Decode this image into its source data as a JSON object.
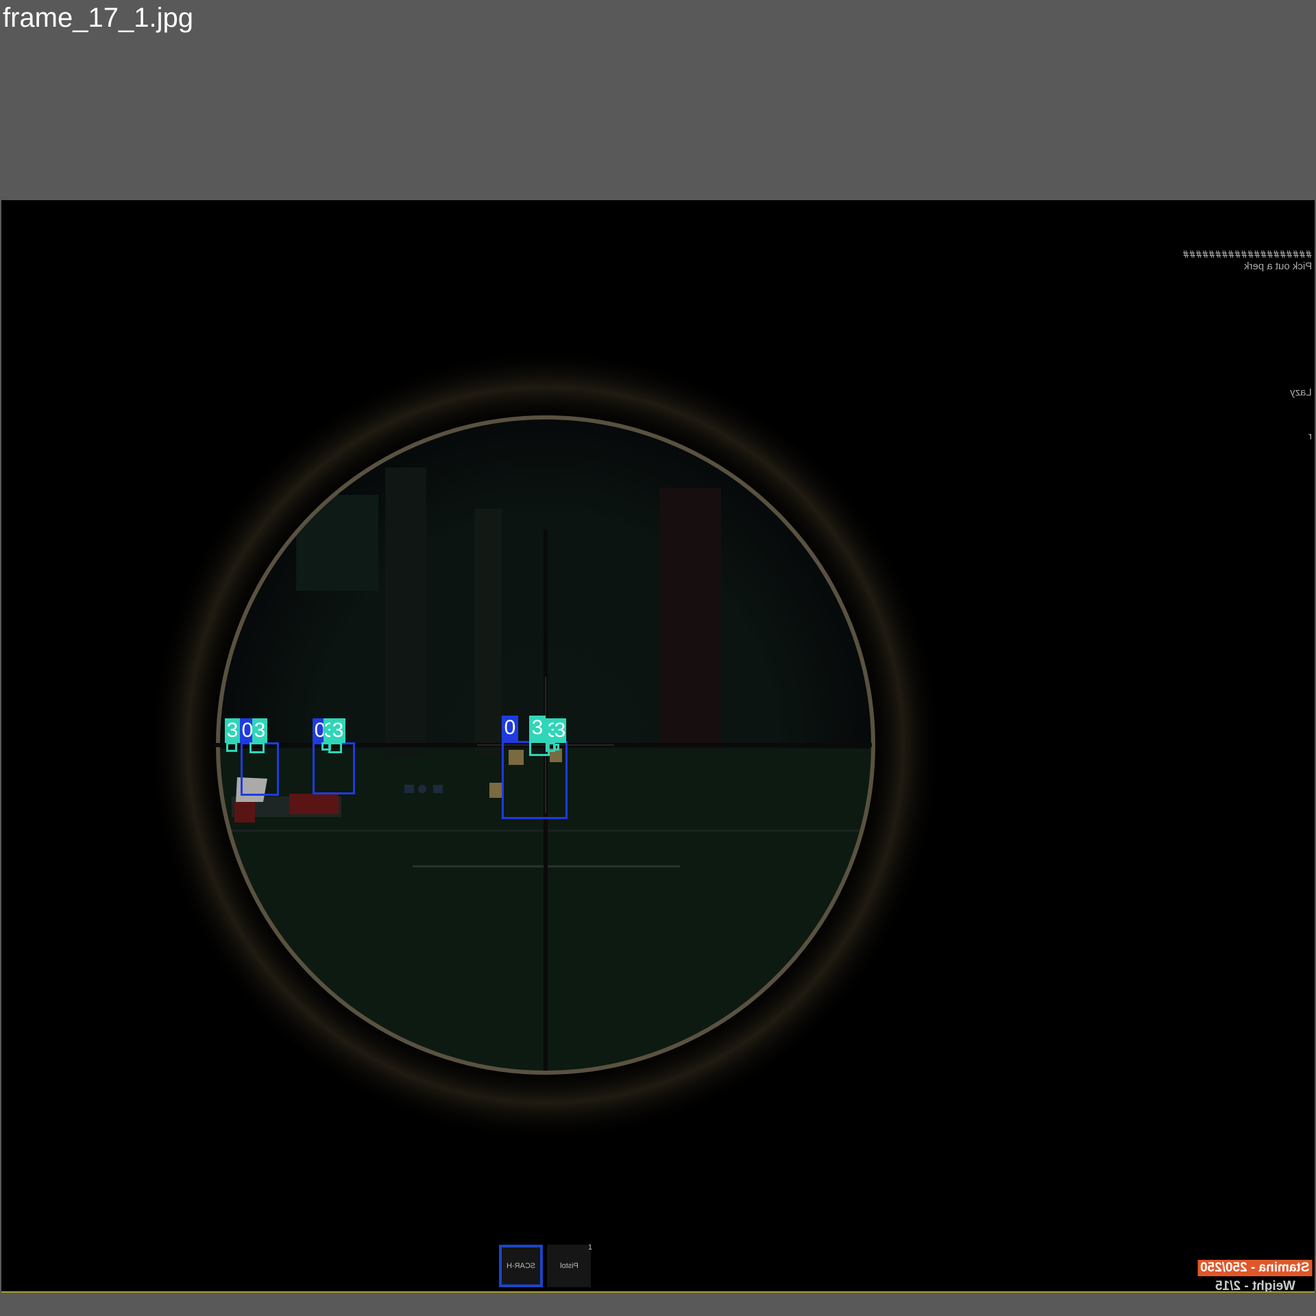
{
  "filename": "frame_17_1.jpg",
  "hud": {
    "perk_hash": "####################",
    "perk_text": "Pick out a perk",
    "side_a": "Lazy",
    "side_b": "r",
    "stamina": "Stamina - 250/250",
    "weight": "Weight - 2/15"
  },
  "hotbar": {
    "slot_1": "SCAR-H",
    "slot_2": "Pistol",
    "slot_number": "1"
  },
  "detection_classes": {
    "blue": {
      "label": "0",
      "color": "#1f3be0"
    },
    "teal": {
      "label": "3",
      "color": "#2fd6b8"
    }
  },
  "detections": [
    {
      "class": "teal",
      "label": "3"
    },
    {
      "class": "blue",
      "label": "0"
    },
    {
      "class": "teal",
      "label": "3"
    },
    {
      "class": "blue",
      "label": "0"
    },
    {
      "class": "teal",
      "label": "3"
    },
    {
      "class": "teal",
      "label": "3"
    },
    {
      "class": "blue",
      "label": "0"
    },
    {
      "class": "teal",
      "label": "3"
    },
    {
      "class": "teal",
      "label": "3"
    },
    {
      "class": "teal",
      "label": "3"
    }
  ]
}
